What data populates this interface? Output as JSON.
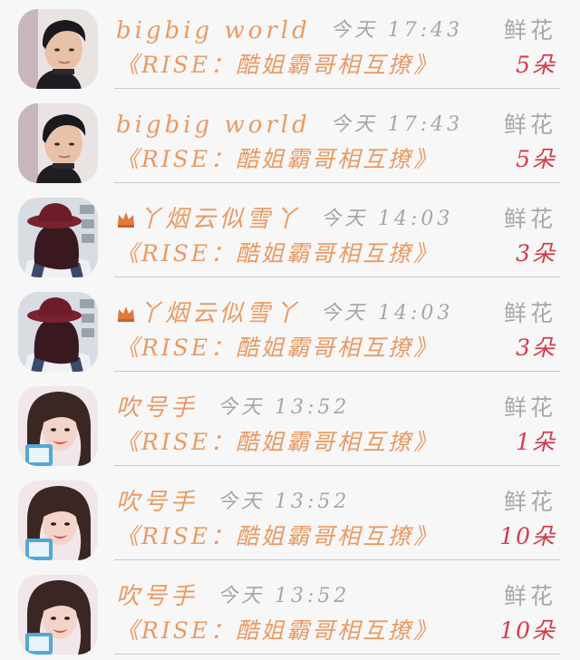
{
  "colors": {
    "name": "#ea9a63",
    "message": "#ea9a63",
    "time": "#a6a6a6",
    "gift_type": "#a8a8a8",
    "gift_count": "#d63a4a",
    "divider": "#c9c9c9",
    "background": "#f7f7f7"
  },
  "rows": [
    {
      "avatar": "boy-avatar",
      "crown": false,
      "name": "bigbig world",
      "time": "今天 17:43",
      "gift_type": "鲜花",
      "message": "《RISE：酷姐霸哥相互撩》",
      "gift_count": "5朵"
    },
    {
      "avatar": "boy-avatar",
      "crown": false,
      "name": "bigbig world",
      "time": "今天 17:43",
      "gift_type": "鲜花",
      "message": "《RISE：酷姐霸哥相互撩》",
      "gift_count": "5朵"
    },
    {
      "avatar": "hat-girl-avatar",
      "crown": true,
      "name": "丫烟云似雪丫",
      "time": "今天 14:03",
      "gift_type": "鲜花",
      "message": "《RISE：酷姐霸哥相互撩》",
      "gift_count": "3朵"
    },
    {
      "avatar": "hat-girl-avatar",
      "crown": true,
      "name": "丫烟云似雪丫",
      "time": "今天 14:03",
      "gift_type": "鲜花",
      "message": "《RISE：酷姐霸哥相互撩》",
      "gift_count": "3朵"
    },
    {
      "avatar": "smiling-girl-avatar",
      "crown": false,
      "name": "吹号手",
      "time": "今天 13:52",
      "gift_type": "鲜花",
      "message": "《RISE：酷姐霸哥相互撩》",
      "gift_count": "1朵"
    },
    {
      "avatar": "smiling-girl-avatar",
      "crown": false,
      "name": "吹号手",
      "time": "今天 13:52",
      "gift_type": "鲜花",
      "message": "《RISE：酷姐霸哥相互撩》",
      "gift_count": "10朵"
    },
    {
      "avatar": "smiling-girl-avatar",
      "crown": false,
      "name": "吹号手",
      "time": "今天 13:52",
      "gift_type": "鲜花",
      "message": "《RISE：酷姐霸哥相互撩》",
      "gift_count": "10朵"
    }
  ]
}
